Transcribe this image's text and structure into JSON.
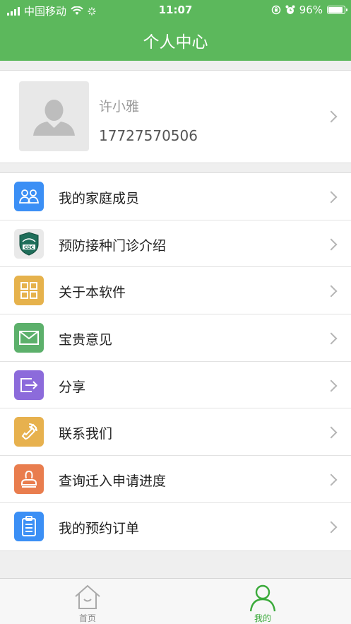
{
  "status": {
    "carrier": "中国移动",
    "time": "11:07",
    "battery": "96%"
  },
  "header": {
    "title": "个人中心"
  },
  "profile": {
    "name": "许小雅",
    "phone": "17727570506"
  },
  "menu": [
    {
      "label": "我的家庭成员",
      "icon": "family-icon",
      "color": "#3b8ff5"
    },
    {
      "label": "预防接种门诊介绍",
      "icon": "cdc-logo-icon",
      "color": "#e9e9e9"
    },
    {
      "label": "关于本软件",
      "icon": "grid-icon",
      "color": "#e6b24c"
    },
    {
      "label": "宝贵意见",
      "icon": "mail-icon",
      "color": "#5cb06b"
    },
    {
      "label": "分享",
      "icon": "share-icon",
      "color": "#8c6bdb"
    },
    {
      "label": "联系我们",
      "icon": "phone-icon",
      "color": "#e7b14e"
    },
    {
      "label": "查询迁入申请进度",
      "icon": "stamp-icon",
      "color": "#e97d4e"
    },
    {
      "label": "我的预约订单",
      "icon": "clipboard-icon",
      "color": "#3b8ff5"
    }
  ],
  "tabs": [
    {
      "label": "首页",
      "active": false
    },
    {
      "label": "我的",
      "active": true
    }
  ],
  "colors": {
    "primary": "#5cb85c",
    "tabActive": "#3aaa3a",
    "tabInactive": "#888888"
  }
}
